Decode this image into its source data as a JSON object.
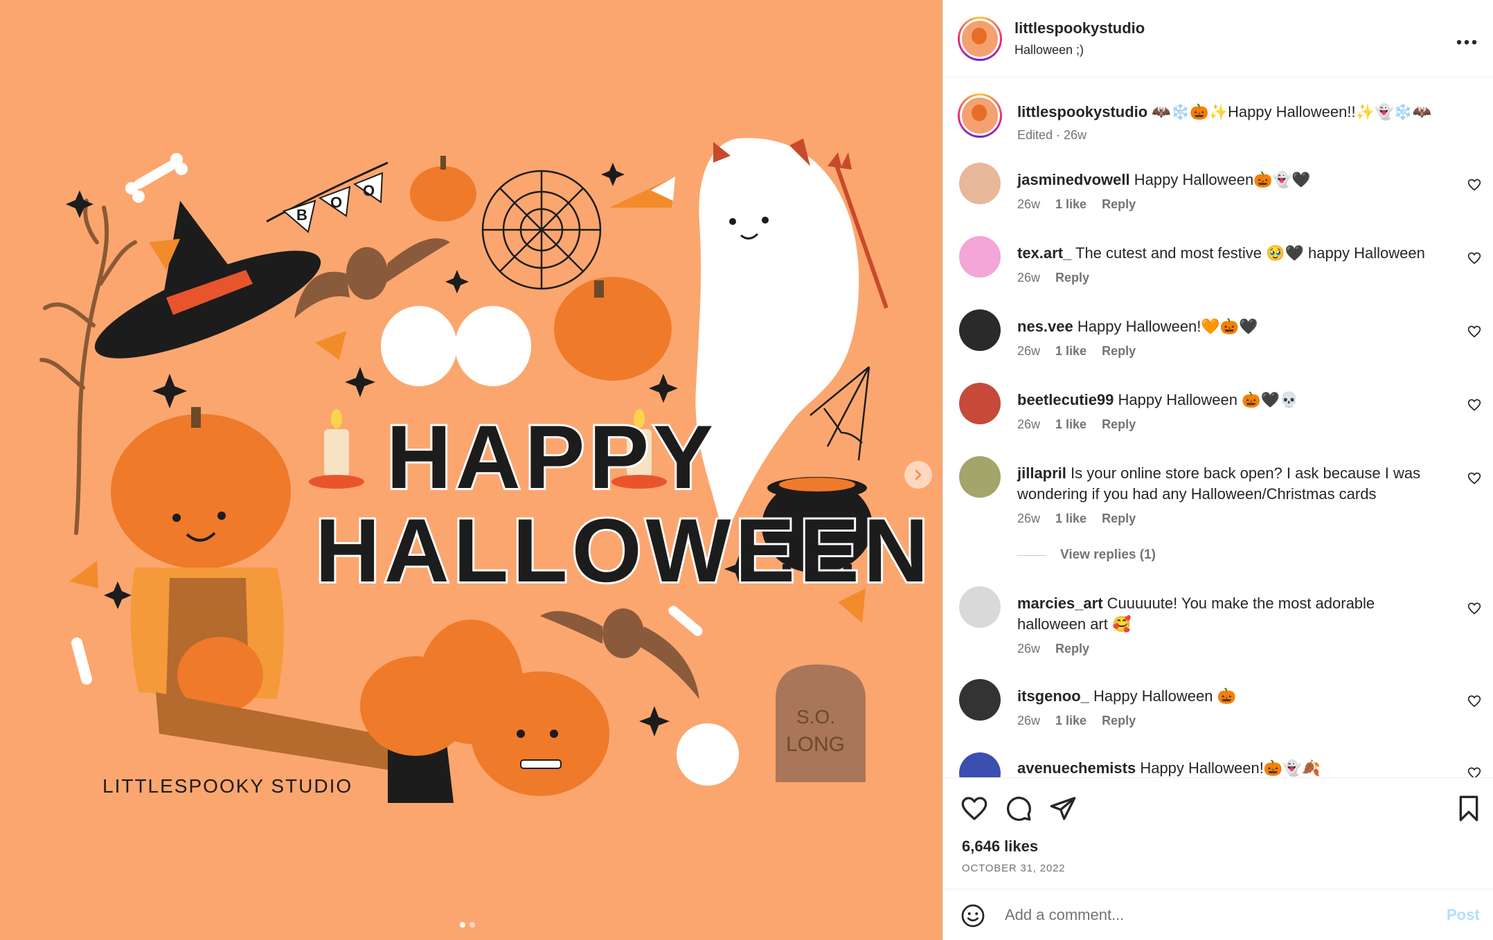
{
  "media": {
    "artwork_title_line1": "HAPPY",
    "artwork_title_line2": "HALLOWEEN",
    "artwork_signature": "LITTLESPOOKY STUDIO",
    "banner_letters": [
      "B",
      "O",
      "O"
    ],
    "tombstone_line1": "S.O.",
    "tombstone_line2": "LONG",
    "background_color": "#fba66f",
    "carousel_slide": 1,
    "carousel_total": 2
  },
  "header": {
    "username": "littlespookystudio",
    "subtitle": "Halloween ;)",
    "more_icon": "more-horizontal-icon"
  },
  "caption": {
    "username": "littlespookystudio",
    "text": "🦇❄️🎃✨Happy Halloween!!✨👻❄️🦇",
    "meta": "Edited · 26w"
  },
  "comments": [
    {
      "username": "jasminedvowell",
      "text": "Happy Halloween🎃👻🖤",
      "age": "26w",
      "likes": "1 like",
      "reply": "Reply"
    },
    {
      "username": "tex.art_",
      "text": "The cutest and most festive 🥹🖤 happy Halloween",
      "age": "26w",
      "likes": "",
      "reply": "Reply"
    },
    {
      "username": "nes.vee",
      "text": "Happy Halloween!🧡🎃🖤",
      "age": "26w",
      "likes": "1 like",
      "reply": "Reply"
    },
    {
      "username": "beetlecutie99",
      "text": "Happy Halloween 🎃🖤💀",
      "age": "26w",
      "likes": "1 like",
      "reply": "Reply"
    },
    {
      "username": "jillapril",
      "text": "Is your online store back open? I ask because I was wondering if you had any Halloween/Christmas cards",
      "age": "26w",
      "likes": "1 like",
      "reply": "Reply",
      "view_replies": "View replies (1)"
    },
    {
      "username": "marcies_art",
      "text": "Cuuuuute! You make the most adorable halloween art 🥰",
      "age": "26w",
      "likes": "",
      "reply": "Reply"
    },
    {
      "username": "itsgenoo_",
      "text": "Happy Halloween 🎃",
      "age": "26w",
      "likes": "1 like",
      "reply": "Reply"
    },
    {
      "username": "avenuechemists",
      "text": "Happy Halloween!🎃👻🍂",
      "age": "",
      "likes": "",
      "reply": ""
    }
  ],
  "actions": {
    "likes": "6,646 likes",
    "date": "OCTOBER 31, 2022",
    "icons": [
      "heart-icon",
      "comment-icon",
      "share-icon",
      "bookmark-icon"
    ]
  },
  "composer": {
    "placeholder": "Add a comment...",
    "post_label": "Post"
  },
  "colors": {
    "accent_blue": "#0095f6",
    "post_disabled": "#b2dffc",
    "secondary_text": "#737373"
  }
}
